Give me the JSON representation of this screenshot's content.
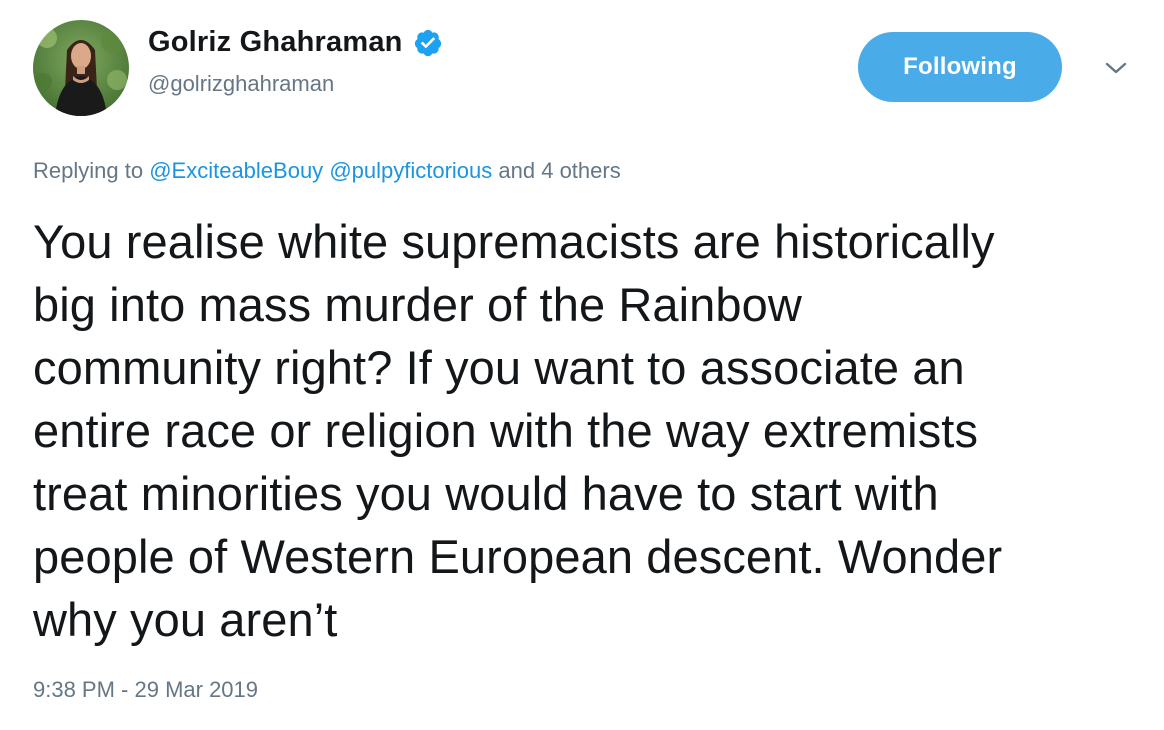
{
  "author": {
    "display_name": "Golriz Ghahraman",
    "handle": "@golrizghahraman",
    "verified": true,
    "avatar_icon": "profile-photo-avatar"
  },
  "follow_button": {
    "label": "Following",
    "color": "#4aabe9"
  },
  "menu": {
    "caret_icon": "chevron-down-icon"
  },
  "reply_context": {
    "prefix": "Replying to",
    "mentions": [
      "@ExciteableBouy",
      "@pulpyfictorious"
    ],
    "suffix": "and 4 others"
  },
  "tweet": {
    "text": "You realise white supremacists are historically\nbig into mass murder of the Rainbow\ncommunity right? If you want to associate an\nentire race or religion with the way extremists\ntreat minorities you would have to start with\npeople of Western European descent. Wonder\nwhy you aren’t",
    "timestamp": "9:38 PM - 29 Mar 2019"
  },
  "colors": {
    "link": "#1b95e0",
    "secondary_text": "#657786",
    "primary_text": "#14171a",
    "verified_badge": "#1da1f2"
  }
}
